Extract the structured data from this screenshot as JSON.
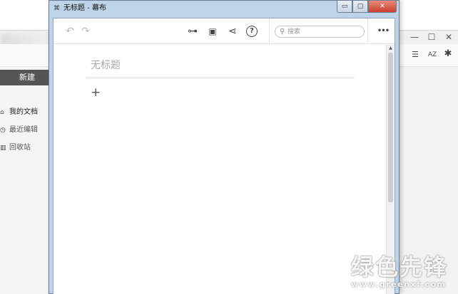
{
  "background_app": {
    "new_button_label": "新建",
    "sidebar_items": [
      {
        "icon": "home-icon",
        "glyph": "⌂",
        "label": "我的文档"
      },
      {
        "icon": "clock-icon",
        "glyph": "◷",
        "label": "最近编辑"
      },
      {
        "icon": "trash-icon",
        "glyph": "▥",
        "label": "回收站"
      }
    ],
    "window_controls": {
      "minimize": "—",
      "maximize": "☐",
      "close": "✕"
    },
    "header_icons": {
      "list": "☰",
      "sort": "AZ",
      "settings": "✱"
    }
  },
  "editor_window": {
    "title": "无标题 - 幕布",
    "app_icon": "⌘",
    "controls": {
      "minimize": "▭",
      "maximize": "▢",
      "close": "✕"
    },
    "toolbar": {
      "undo": "↶",
      "redo": "↷",
      "mindmap": "⊶",
      "present": "▣",
      "share": "⋖",
      "help": "?",
      "more": "•••",
      "search_icon": "⚲",
      "search_placeholder": "搜索"
    },
    "document": {
      "title_placeholder": "无标题",
      "add_node": "+"
    },
    "scrollbar": {
      "up_arrow": "▲"
    }
  },
  "watermark": {
    "text": "绿色先锋",
    "url": "www.greenxf.com"
  },
  "colors": {
    "new_button_bg": "#555555",
    "editor_frame": "#bcd3e8",
    "close_button": "#c8402c"
  }
}
